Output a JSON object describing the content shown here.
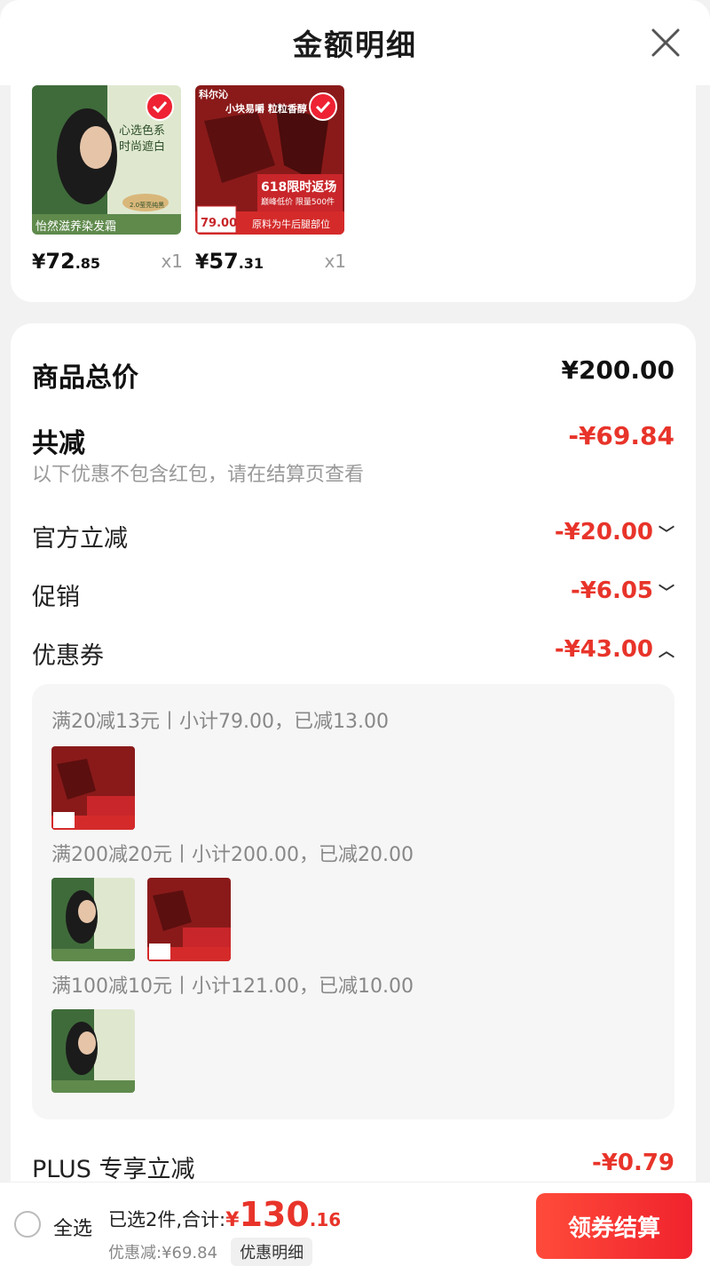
{
  "header": {
    "title": "金额明细"
  },
  "products": [
    {
      "price_yen": "¥",
      "price_int": "72",
      "price_dec": ".85",
      "qty": "x1",
      "thumb": {
        "line1": "心选色系",
        "line2": "时尚遮白",
        "bottom": "怡然滋养染发霜",
        "badge": "2.0莹亮纯黑"
      }
    },
    {
      "price_yen": "¥",
      "price_int": "57",
      "price_dec": ".31",
      "qty": "x1",
      "thumb": {
        "brand": "科尔沁",
        "line1": "小块易嚼 粒粒香醇",
        "promo1": "618限时返场",
        "promo2": "巅峰低价 限量500件",
        "tag": "79.00",
        "bottom": "原料为牛后腿部位"
      }
    }
  ],
  "summary": {
    "total_label": "商品总价",
    "total_value": "¥200.00",
    "reduce_label": "共减",
    "reduce_value": "-¥69.84",
    "reduce_note": "以下优惠不包含红包，请在结算页查看",
    "official_label": "官方立减",
    "official_value": "-¥20.00",
    "promo_label": "促销",
    "promo_value": "-¥6.05",
    "coupon_label": "优惠券",
    "coupon_value": "-¥43.00",
    "plus_label": "PLUS 专享立减",
    "plus_value": "-¥0.79"
  },
  "coupons": [
    {
      "text": "满20减13元丨小计79.00，已减13.00"
    },
    {
      "text": "满200减20元丨小计200.00，已减20.00"
    },
    {
      "text": "满100减10元丨小计121.00，已减10.00"
    }
  ],
  "bottom_bar": {
    "select_all": "全选",
    "selected_label": "已选2件,合计:",
    "total_yen": "¥",
    "total_int": "130",
    "total_dec": ".16",
    "discount_label": "优惠减:¥69.84",
    "detail_button": "优惠明细",
    "checkout_button": "领券结算"
  },
  "colors": {
    "accent_red": "#e8342a",
    "checkout_red": "#f0232d",
    "hair_green": "#5f8a4c",
    "beef_red": "#8a1a1a"
  }
}
